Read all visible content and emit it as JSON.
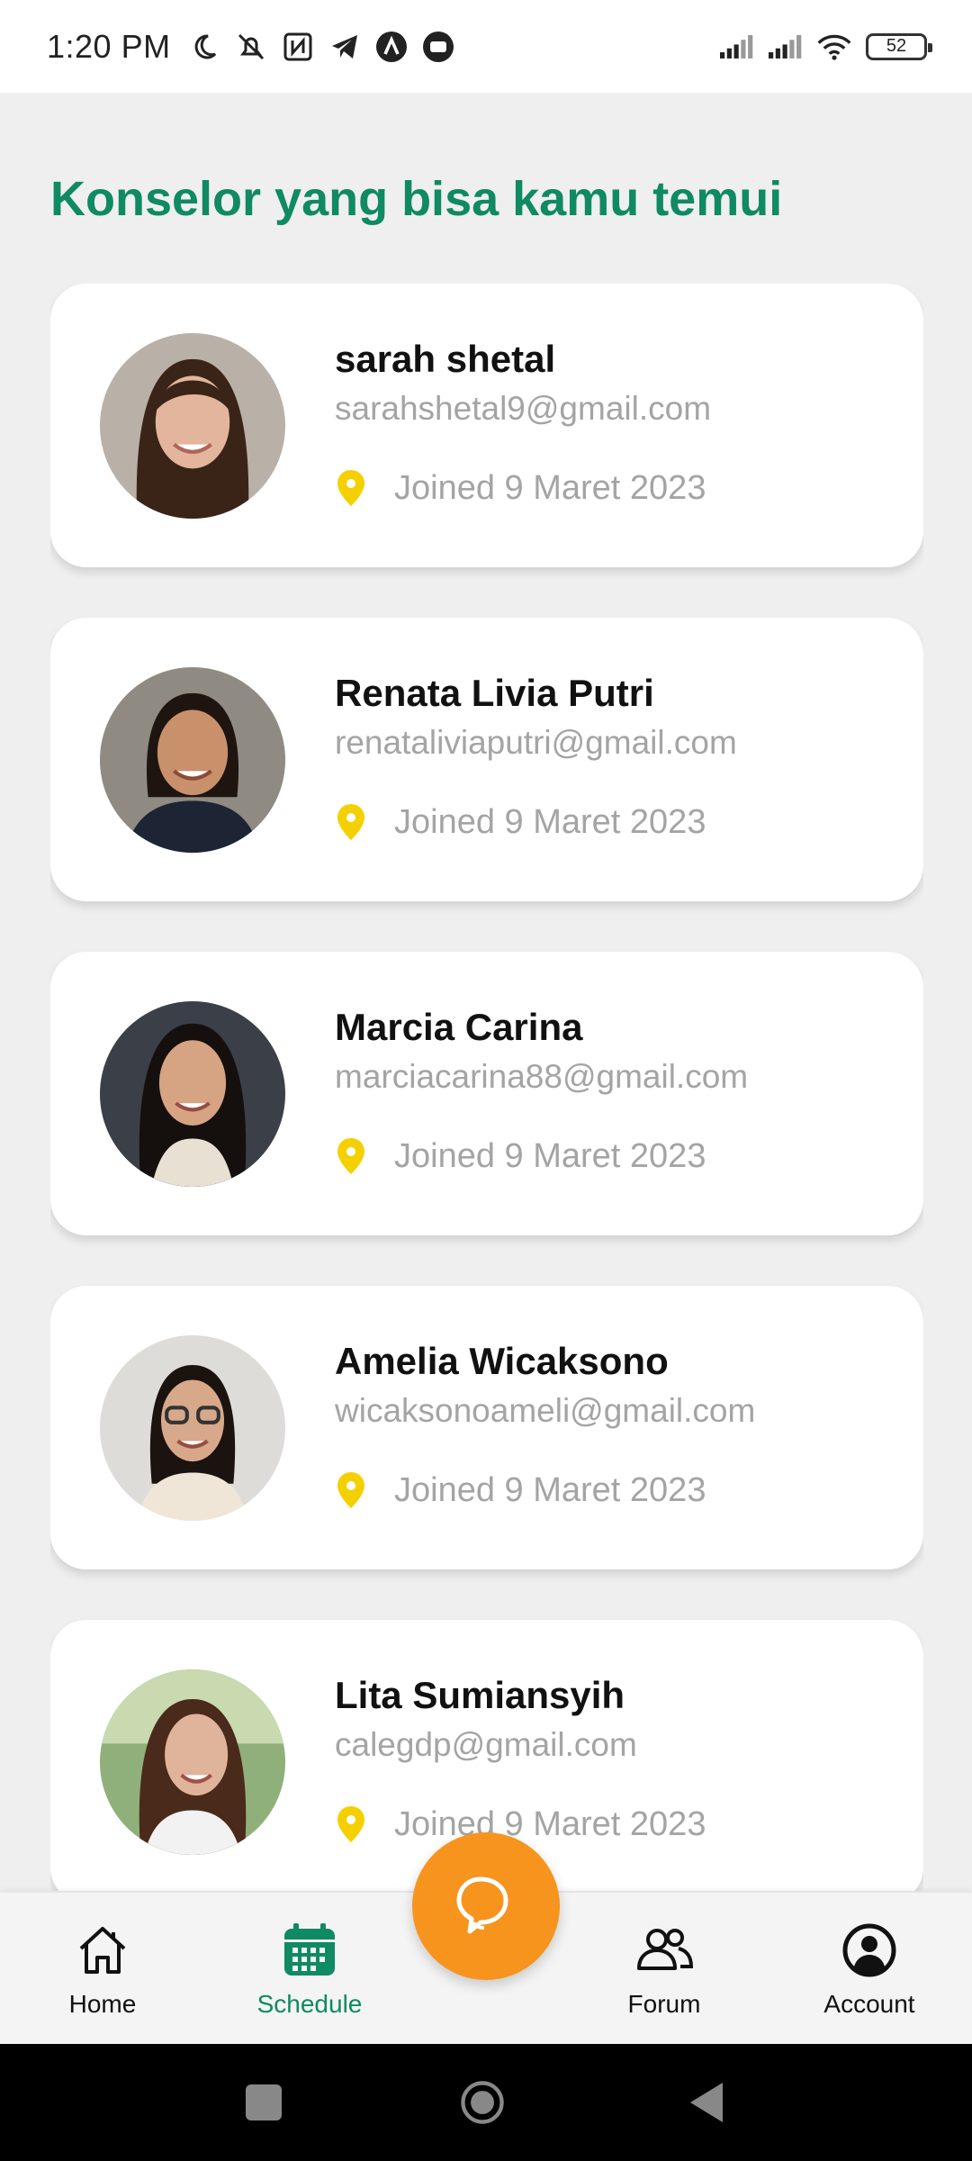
{
  "status_bar": {
    "time": "1:20 PM",
    "battery": "52",
    "icons": [
      "moon-icon",
      "bell-off-icon",
      "nfc-icon",
      "telegram-icon",
      "app-a-icon",
      "chat-bubble-icon",
      "signal-icon",
      "signal-icon",
      "wifi-icon",
      "battery-icon"
    ]
  },
  "page": {
    "title": "Konselor yang bisa kamu temui"
  },
  "counselors": [
    {
      "name": "sarah shetal",
      "email": "sarahshetal9@gmail.com",
      "joined": "Joined 9 Maret 2023"
    },
    {
      "name": "Renata Livia Putri",
      "email": "renataliviaputri@gmail.com",
      "joined": "Joined 9 Maret 2023"
    },
    {
      "name": "Marcia Carina",
      "email": "marciacarina88@gmail.com",
      "joined": "Joined 9 Maret 2023"
    },
    {
      "name": "Amelia Wicaksono",
      "email": "wicaksonoameli@gmail.com",
      "joined": "Joined 9 Maret 2023"
    },
    {
      "name": "Lita Sumiansyih",
      "email": "calegdp@gmail.com",
      "joined": "Joined 9 Maret 2023"
    }
  ],
  "bottom_nav": {
    "home": "Home",
    "schedule": "Schedule",
    "forum": "Forum",
    "account": "Account",
    "active": "schedule"
  },
  "colors": {
    "accent": "#0f8a63",
    "fab": "#f7941d",
    "pin": "#f5d000",
    "muted_text": "#a4a4a4"
  }
}
